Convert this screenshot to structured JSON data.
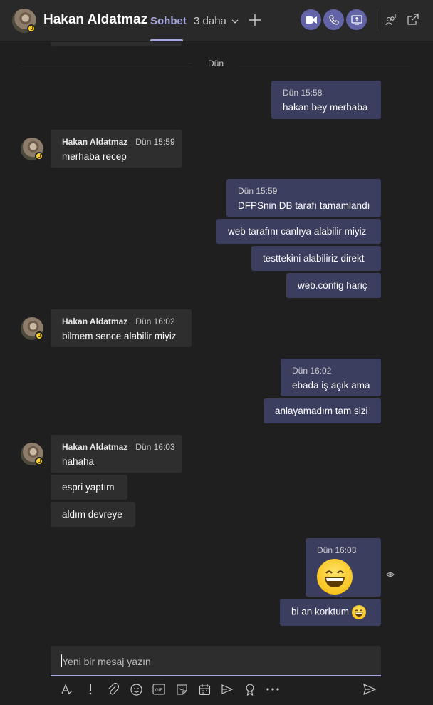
{
  "header": {
    "contact_name": "Hakan Aldatmaz",
    "active_tab": "Sohbet",
    "more_tabs": "3 daha",
    "add_tab_icon": "plus-icon",
    "video_call_icon": "video-camera-icon",
    "audio_call_icon": "phone-icon",
    "share_screen_icon": "share-screen-icon",
    "add_people_icon": "add-people-icon",
    "pop_out_icon": "pop-out-icon",
    "accent_color": "#6264a7",
    "status": "away"
  },
  "date_divider": "Dün",
  "messages": {
    "m1": {
      "time": "Dün 15:58",
      "text": "hakan bey merhaba"
    },
    "m2": {
      "sender": "Hakan Aldatmaz",
      "time": "Dün 15:59",
      "text": "merhaba recep"
    },
    "m3": {
      "time": "Dün 15:59",
      "text": "DFPSnin DB tarafı tamamlandı"
    },
    "m4": {
      "text": "web tarafını canlıya alabilir miyiz"
    },
    "m5": {
      "text": "testtekini alabiliriz direkt"
    },
    "m6": {
      "text": "web.config hariç"
    },
    "m7": {
      "sender": "Hakan Aldatmaz",
      "time": "Dün 16:02",
      "text": "bilmem sence alabilir miyiz"
    },
    "m8": {
      "time": "Dün 16:02",
      "text": "ebada iş açık ama"
    },
    "m9": {
      "text": "anlayamadım tam sizi"
    },
    "m10": {
      "sender": "Hakan Aldatmaz",
      "time": "Dün 16:03",
      "text": "hahaha"
    },
    "m11": {
      "text": "espri yaptım"
    },
    "m12": {
      "text": "aldım devreye"
    },
    "m13": {
      "time": "Dün 16:03",
      "emoji": "grinning-face-emoji"
    },
    "m14": {
      "text": "bi an korktum",
      "emoji": "grinning-face-emoji"
    }
  },
  "compose": {
    "placeholder": "Yeni bir mesaj yazın",
    "tools": [
      "format-icon",
      "important-icon",
      "attach-icon",
      "emoji-icon",
      "gif-icon",
      "sticker-icon",
      "meeting-icon",
      "stream-icon",
      "praise-icon",
      "more-icon"
    ],
    "send_icon": "send-icon"
  },
  "seen_icon": "eye-icon"
}
